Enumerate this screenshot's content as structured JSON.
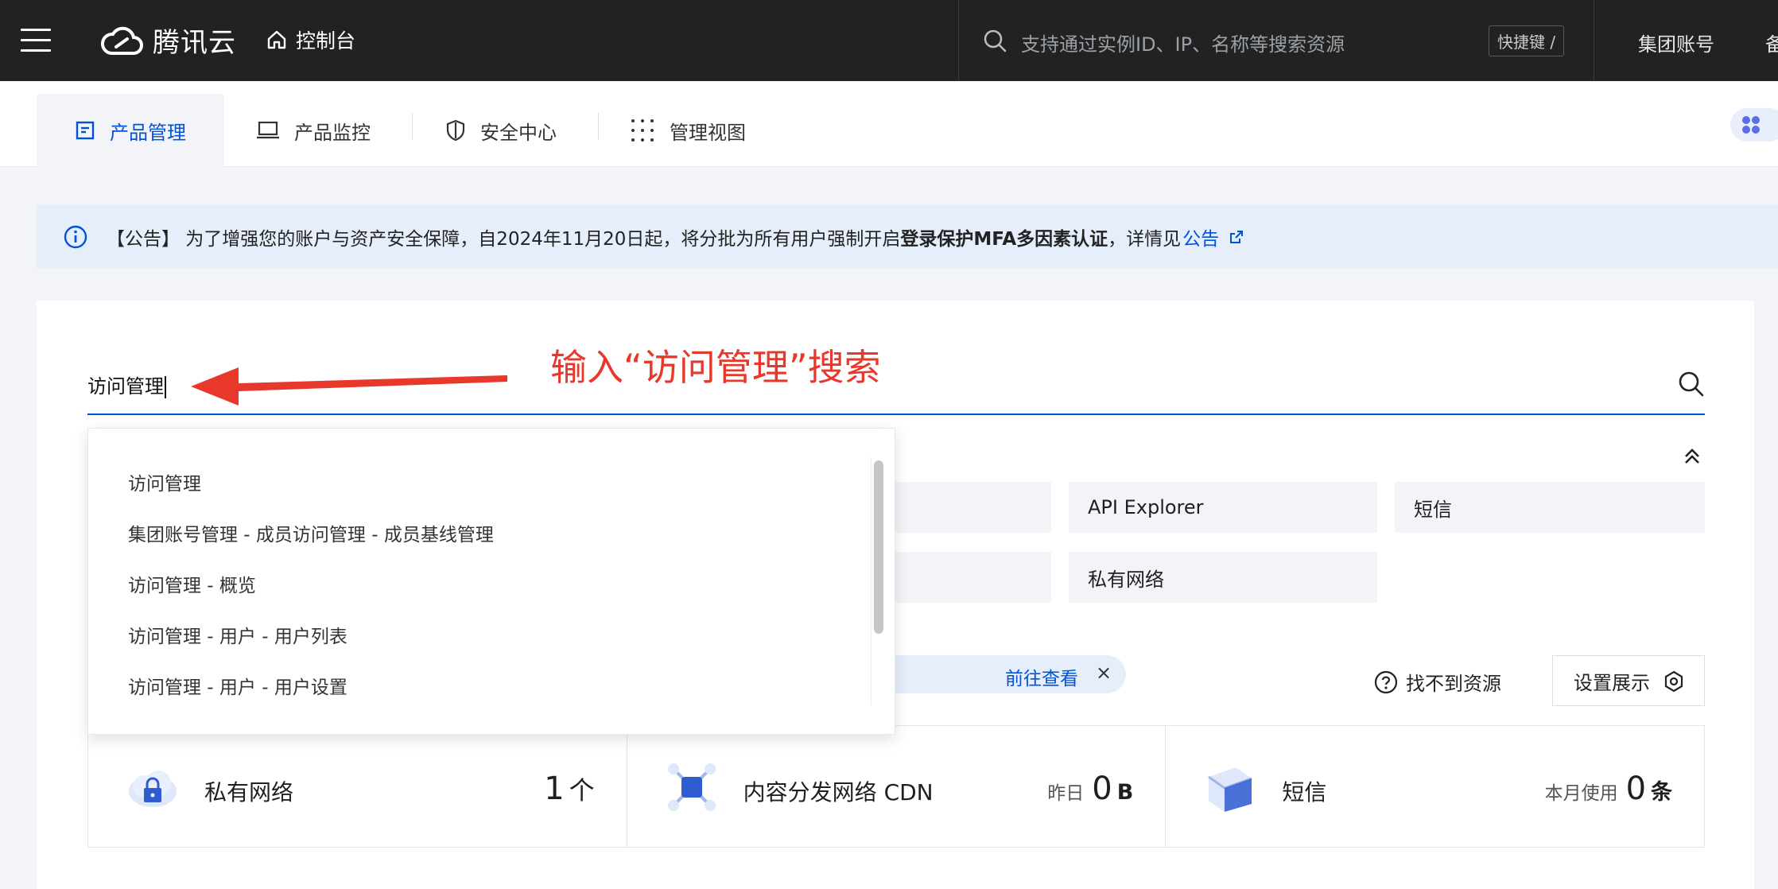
{
  "topbar": {
    "logo_text": "腾讯云",
    "console_label": "控制台",
    "search_placeholder": "支持通过实例ID、IP、名称等搜索资源",
    "shortcut_label": "快捷键 /",
    "group_account": "集团账号",
    "clipped_item": "备"
  },
  "tabs": [
    {
      "label": "产品管理"
    },
    {
      "label": "产品监控"
    },
    {
      "label": "安全中心"
    },
    {
      "label": "管理视图"
    }
  ],
  "notice": {
    "prefix": "【公告】 为了增强您的账户与资产安全保障，自2024年11月20日起，将分批为所有用户强制开启",
    "bold": "登录保护MFA多因素认证",
    "suffix": "，详情见",
    "link": "公告"
  },
  "search": {
    "value": "访问管理",
    "annotation": "输入“访问管理”搜索"
  },
  "dropdown": {
    "items": [
      "访问管理",
      "集团账号管理 - 成员访问管理 - 成员基线管理",
      "访问管理 - 概览",
      "访问管理 - 用户 - 用户列表",
      "访问管理 - 用户 - 用户设置"
    ]
  },
  "shortcuts": [
    "API Explorer",
    "短信",
    "私有网络"
  ],
  "recent": {
    "go_label": "前往查看",
    "close": "×"
  },
  "actions": {
    "not_found": "找不到资源",
    "settings": "设置展示"
  },
  "stats": [
    {
      "name": "私有网络",
      "label": "",
      "value": "1",
      "unit": "个"
    },
    {
      "name": "内容分发网络 CDN",
      "label": "昨日",
      "value": "0",
      "unit": "B"
    },
    {
      "name": "短信",
      "label": "本月使用",
      "value": "0",
      "unit": "条"
    }
  ],
  "colors": {
    "accent": "#0052d9",
    "topbar": "#222222",
    "annotation": "#e8382c",
    "notice_bg": "#e6eefc"
  }
}
